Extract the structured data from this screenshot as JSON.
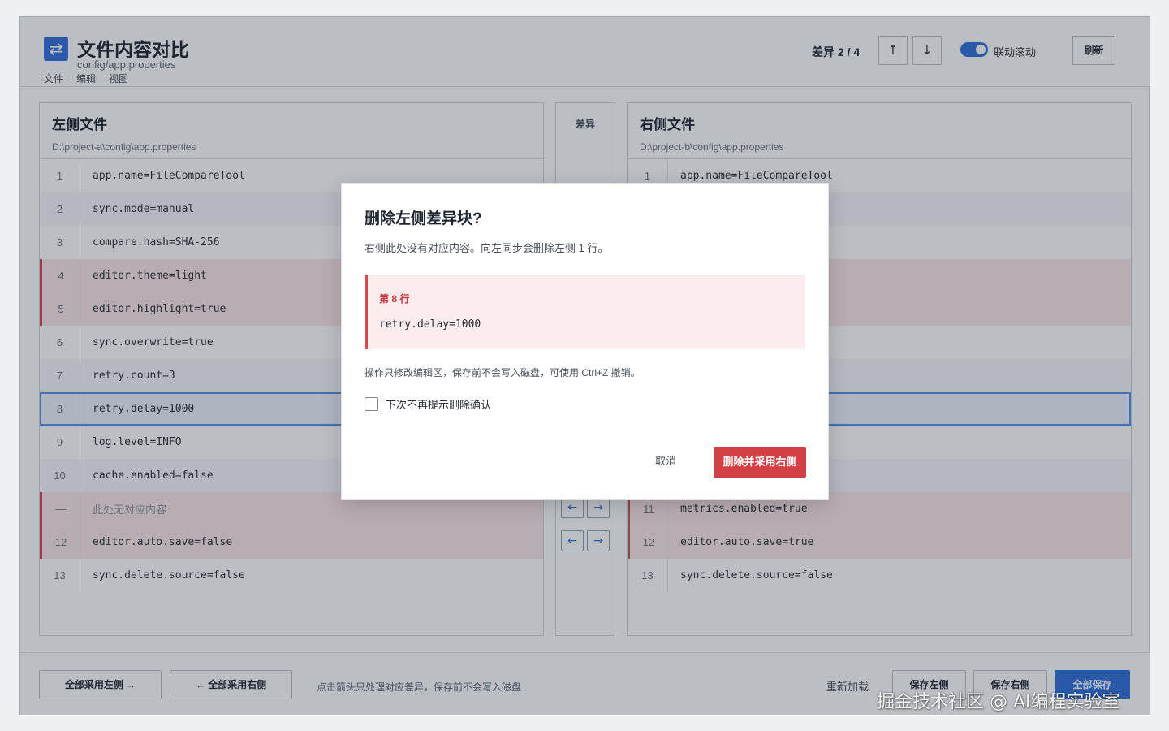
{
  "app": {
    "icon": "swap-arrows-icon",
    "title": "文件内容对比",
    "subtitle": "config/app.properties",
    "menu": [
      "文件",
      "编辑",
      "视图"
    ]
  },
  "toolbar": {
    "diff_counter": "差异 2 / 4",
    "prev_label": "↑",
    "next_label": "↓",
    "sync_scroll_label": "联动滚动",
    "sync_scroll_on": true,
    "refresh_label": "刷新"
  },
  "left": {
    "title": "左侧文件",
    "path": "D:\\project-a\\config\\app.properties",
    "rows": [
      {
        "ln": "1",
        "code": "app.name=FileCompareTool"
      },
      {
        "ln": "2",
        "code": "sync.mode=manual"
      },
      {
        "ln": "3",
        "code": "compare.hash=SHA-256"
      },
      {
        "ln": "4",
        "code": "editor.theme=light"
      },
      {
        "ln": "5",
        "code": "editor.highlight=true"
      },
      {
        "ln": "6",
        "code": "sync.overwrite=true"
      },
      {
        "ln": "7",
        "code": "retry.count=3"
      },
      {
        "ln": "8",
        "code": "retry.delay=1000"
      },
      {
        "ln": "9",
        "code": "log.level=INFO"
      },
      {
        "ln": "10",
        "code": "cache.enabled=false"
      },
      {
        "ln": "—",
        "code": "此处无对应内容"
      },
      {
        "ln": "12",
        "code": "editor.auto.save=false"
      },
      {
        "ln": "13",
        "code": "sync.delete.source=false"
      }
    ]
  },
  "middle": {
    "title": "差异",
    "left_arrow": "←",
    "right_arrow": "→"
  },
  "right": {
    "title": "右侧文件",
    "path": "D:\\project-b\\config\\app.properties",
    "rows": [
      {
        "ln": "1",
        "code": "app.name=FileCompareTool"
      },
      {
        "ln": "11",
        "code": "metrics.enabled=true"
      },
      {
        "ln": "12",
        "code": "editor.auto.save=true"
      },
      {
        "ln": "13",
        "code": "sync.delete.source=false"
      }
    ]
  },
  "footer": {
    "use_all_left": "全部采用左侧 →",
    "use_all_right": "← 全部采用右侧",
    "hint": "点击箭头只处理对应差异，保存前不会写入磁盘",
    "reload": "重新加载",
    "save_left": "保存左侧",
    "save_right": "保存右侧",
    "save_all": "全部保存"
  },
  "modal": {
    "title": "删除左侧差异块?",
    "description": "右侧此处没有对应内容。向左同步会删除左侧 1 行。",
    "line_label": "第 8 行",
    "line_code": "retry.delay=1000",
    "note": "操作只修改编辑区，保存前不会写入磁盘，可使用 Ctrl+Z 撤销。",
    "checkbox_label": "下次不再提示删除确认",
    "checkbox_checked": false,
    "cancel": "取消",
    "confirm": "删除并采用右侧"
  },
  "watermark": "掘金技术社区 @ AI编程实验室",
  "colors": {
    "accent": "#2f6fd9",
    "danger": "#d23f45",
    "deleted_bg": "#fbe7e8"
  }
}
